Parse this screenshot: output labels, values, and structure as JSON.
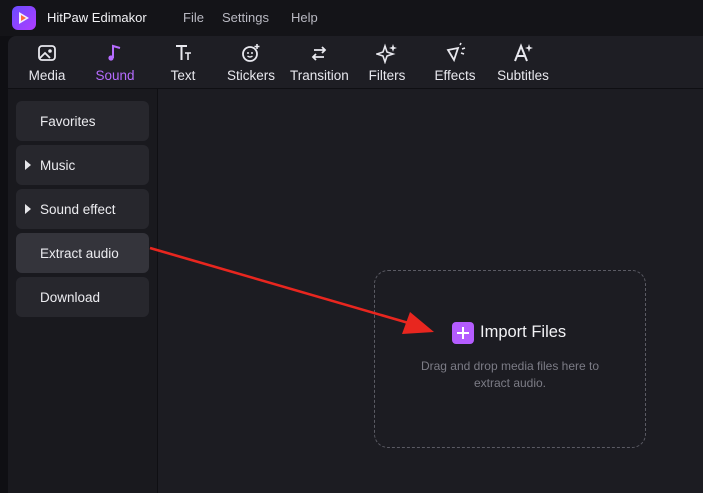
{
  "app": {
    "title": "HitPaw Edimakor"
  },
  "menu": [
    {
      "label": "File"
    },
    {
      "label": "Settings"
    },
    {
      "label": "Help"
    }
  ],
  "toolbar": {
    "active": "Sound",
    "tabs": [
      {
        "label": "Media",
        "icon": "image-icon"
      },
      {
        "label": "Sound",
        "icon": "music-note-icon"
      },
      {
        "label": "Text",
        "icon": "text-icon"
      },
      {
        "label": "Stickers",
        "icon": "sticker-icon"
      },
      {
        "label": "Transition",
        "icon": "transition-icon"
      },
      {
        "label": "Filters",
        "icon": "sparkle-filter-icon"
      },
      {
        "label": "Effects",
        "icon": "effects-icon"
      },
      {
        "label": "Subtitles",
        "icon": "subtitles-icon"
      }
    ]
  },
  "sidebar": {
    "selected": "Extract audio",
    "items": [
      {
        "label": "Favorites"
      },
      {
        "label": "Music"
      },
      {
        "label": "Sound effect"
      },
      {
        "label": "Extract audio"
      },
      {
        "label": "Download"
      }
    ]
  },
  "main": {
    "import_label": "Import Files",
    "hint_line1": "Drag and drop media files here to",
    "hint_line2": "extract audio."
  },
  "colors": {
    "accent": "#b45cff",
    "annotation_arrow": "#e8261f"
  }
}
